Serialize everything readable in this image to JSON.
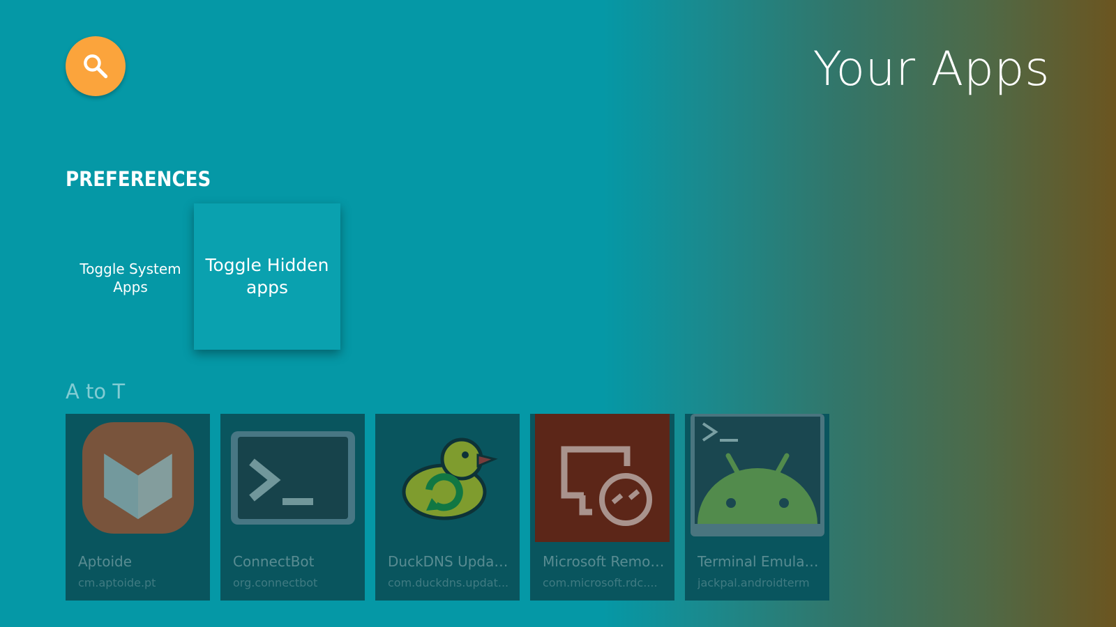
{
  "header": {
    "title": "Your Apps",
    "search_icon": "search-icon",
    "search_color": "#fba43c"
  },
  "preferences": {
    "heading": "PREFERENCES",
    "items": [
      {
        "label": "Toggle System Apps",
        "focused": false
      },
      {
        "label": "Toggle Hidden apps",
        "focused": true
      }
    ]
  },
  "apps": {
    "heading": "A to T",
    "items": [
      {
        "name": "Aptoide",
        "package": "cm.aptoide.pt",
        "icon": "aptoide-icon"
      },
      {
        "name": "ConnectBot",
        "package": "org.connectbot",
        "icon": "terminal-icon"
      },
      {
        "name": "DuckDNS Updater",
        "package": "com.duckdns.updat...",
        "icon": "duck-icon"
      },
      {
        "name": "Microsoft Remot...",
        "package": "com.microsoft.rdc....",
        "icon": "remote-desktop-icon"
      },
      {
        "name": "Terminal Emulator",
        "package": "jackpal.androidterm",
        "icon": "android-terminal-icon"
      }
    ]
  },
  "colors": {
    "background_start": "#0598a6",
    "background_end": "#6b5520",
    "focused_card": "#0aa1af"
  }
}
